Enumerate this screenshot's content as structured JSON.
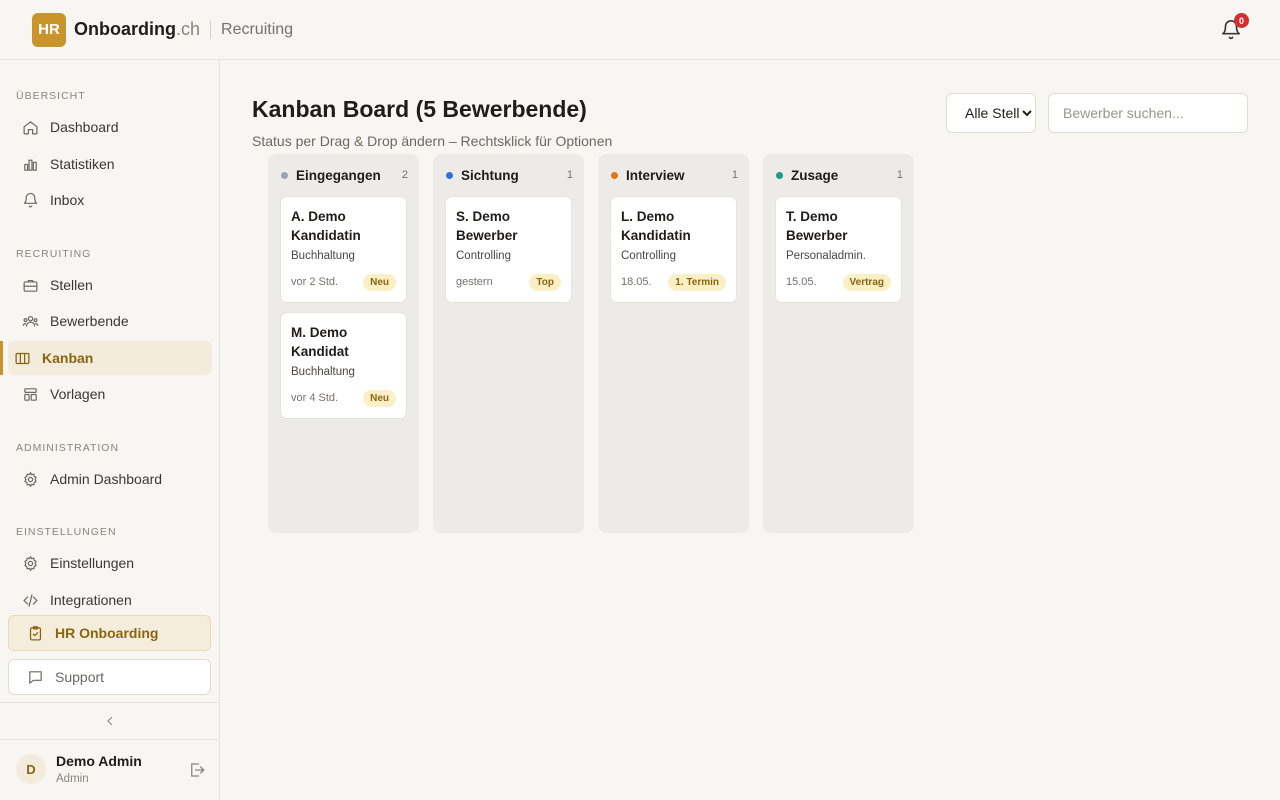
{
  "header": {
    "logo_badge": "HR",
    "brand_main": "Onboarding",
    "brand_suffix": ".ch",
    "section": "Recruiting",
    "notification_count": "0"
  },
  "sidebar": {
    "sections": [
      {
        "title": "Übersicht",
        "items": [
          {
            "label": "Dashboard",
            "icon": "home-icon"
          },
          {
            "label": "Statistiken",
            "icon": "bar-chart-icon"
          },
          {
            "label": "Inbox",
            "icon": "bell-icon"
          }
        ]
      },
      {
        "title": "Recruiting",
        "items": [
          {
            "label": "Stellen",
            "icon": "briefcase-icon"
          },
          {
            "label": "Bewerbende",
            "icon": "users-icon"
          },
          {
            "label": "Kanban",
            "icon": "columns-icon",
            "active": true
          },
          {
            "label": "Vorlagen",
            "icon": "template-icon"
          }
        ]
      },
      {
        "title": "Administration",
        "items": [
          {
            "label": "Admin Dashboard",
            "icon": "gear-icon"
          }
        ]
      },
      {
        "title": "Einstellungen",
        "items": [
          {
            "label": "Einstellungen",
            "icon": "gear-icon"
          },
          {
            "label": "Integrationen",
            "icon": "code-icon"
          }
        ]
      }
    ],
    "hr_onboarding": "HR Onboarding",
    "support": "Support",
    "collapse_icon": "chevron-left-icon",
    "user": {
      "initial": "D",
      "name": "Demo Admin",
      "role": "Admin"
    }
  },
  "main": {
    "title": "Kanban Board (5 Bewerbende)",
    "subtitle": "Status per Drag & Drop ändern – Rechtsklick für Optionen",
    "filter_selected": "Alle Stellen",
    "search_placeholder": "Bewerber suchen...",
    "columns": [
      {
        "title": "Eingegangen",
        "count": "2",
        "color": "#9aa3b5",
        "cards": [
          {
            "name": "A. Demo Kandidatin",
            "dept": "Buchhaltung",
            "time": "vor 2 Std.",
            "tag": "Neu"
          },
          {
            "name": "M. Demo Kandidat",
            "dept": "Buchhaltung",
            "time": "vor 4 Std.",
            "tag": "Neu"
          }
        ]
      },
      {
        "title": "Sichtung",
        "count": "1",
        "color": "#2f6fe0",
        "cards": [
          {
            "name": "S. Demo Bewerber",
            "dept": "Controlling",
            "time": "gestern",
            "tag": "Top"
          }
        ]
      },
      {
        "title": "Interview",
        "count": "1",
        "color": "#e07a10",
        "cards": [
          {
            "name": "L. Demo Kandidatin",
            "dept": "Controlling",
            "time": "18.05.",
            "tag": "1. Termin"
          }
        ]
      },
      {
        "title": "Zusage",
        "count": "1",
        "color": "#1a9a8a",
        "cards": [
          {
            "name": "T. Demo Bewerber",
            "dept": "Personaladmin.",
            "time": "15.05.",
            "tag": "Vertrag"
          }
        ]
      }
    ]
  }
}
